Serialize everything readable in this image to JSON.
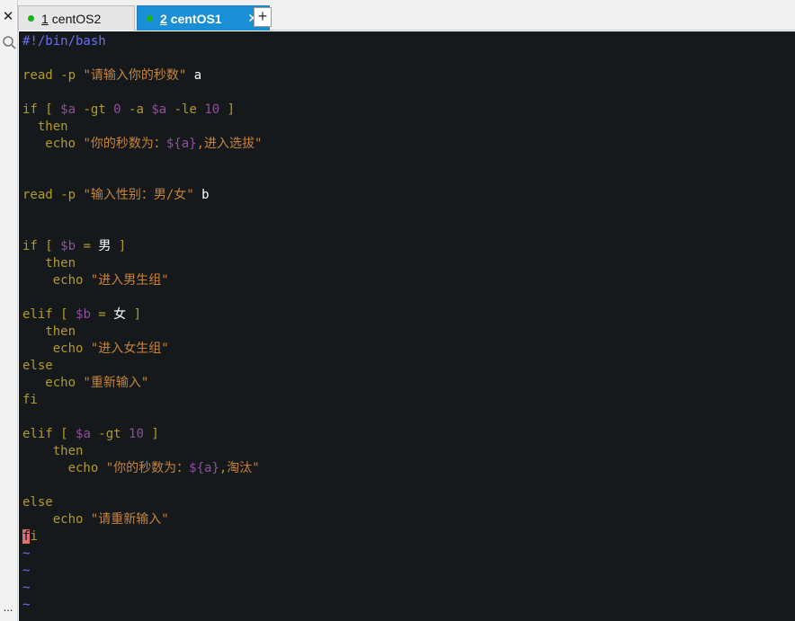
{
  "sidebar": {
    "close_glyph": "✕",
    "search_icon": "search-icon",
    "more_glyph": "..."
  },
  "tabs": [
    {
      "number": "1",
      "label": " centOS2",
      "status_color": "#19b31a",
      "active": false
    },
    {
      "number": "2",
      "label": " centOS1",
      "status_color": "#19b31a",
      "active": true,
      "close_glyph": "✕"
    }
  ],
  "new_tab_glyph": "+",
  "editor": {
    "shebang": "#!/bin/bash",
    "l3_cmd": "read ",
    "l3_opt": "-p ",
    "l3_str": "\"请输入你的秒数\"",
    "l3_var": " a",
    "l5_if": "if [ ",
    "l5_a1": "$a",
    "l5_gt": " -gt ",
    "l5_0": "0",
    "l5_and": " -a ",
    "l5_a2": "$a",
    "l5_le": " -le ",
    "l5_10": "10",
    "l5_close": " ]",
    "l6_then": "  then",
    "l7_echo": "   echo ",
    "l7_s1": "\"你的秒数为：",
    "l7_var": "${a}",
    "l7_s2": ",进入选拔\"",
    "l10_cmd": "read ",
    "l10_opt": "-p ",
    "l10_str": "\"输入性别：男/女\"",
    "l10_var": " b",
    "l13_if": "if [ ",
    "l13_b": "$b",
    "l13_eq": " = ",
    "l13_val": "男",
    "l13_close": " ]",
    "l14_then": "   then",
    "l15_echo": "    echo ",
    "l15_str": "\"进入男生组\"",
    "l17_elif": "elif [ ",
    "l17_b": "$b",
    "l17_eq": " = ",
    "l17_val": "女",
    "l17_close": " ]",
    "l18_then": "   then",
    "l19_echo": "    echo ",
    "l19_str": "\"进入女生组\"",
    "l20_else": "else",
    "l21_echo": "   echo ",
    "l21_str": "\"重新输入\"",
    "l22_fi": "fi",
    "l24_elif": "elif [ ",
    "l24_a": "$a",
    "l24_gt": " -gt ",
    "l24_10": "10",
    "l24_close": " ]",
    "l25_then": "    then",
    "l26_echo": "      echo ",
    "l26_s1": "\"你的秒数为：",
    "l26_var": "${a}",
    "l26_s2": ",淘汰\"",
    "l28_else": "else",
    "l29_echo": "    echo ",
    "l29_str": "\"请重新输入\"",
    "l30_f": "f",
    "l30_i": "i",
    "tilde": "~"
  },
  "colors": {
    "background": "#16191c",
    "keyword": "#b29a2a",
    "string": "#c5843c",
    "variable": "#8e4f9a",
    "comment": "#6a6ff5",
    "active_tab": "#1b8fd6"
  }
}
